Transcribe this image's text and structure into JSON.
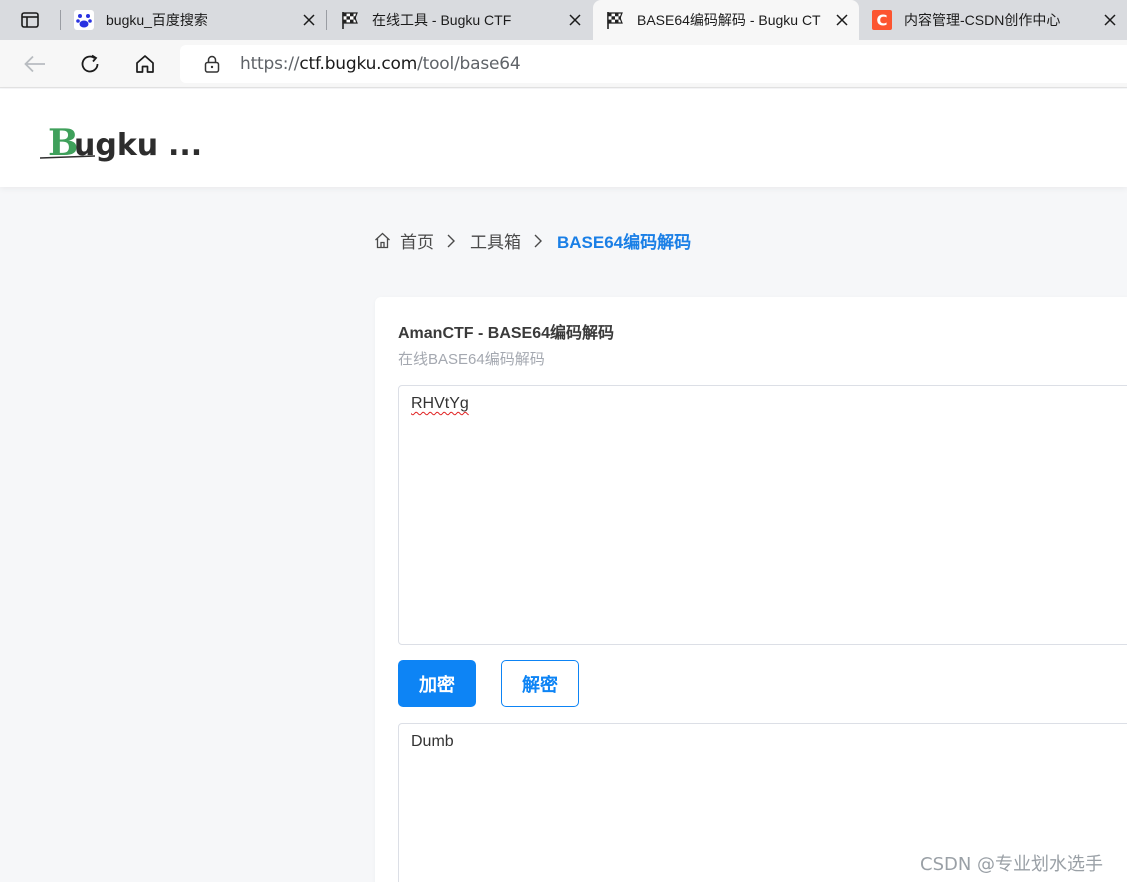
{
  "browser": {
    "tabs": [
      {
        "title": "bugku_百度搜索",
        "favicon": "baidu-paw-icon",
        "active": false
      },
      {
        "title": "在线工具 - Bugku CTF",
        "favicon": "checkered-flag-icon",
        "active": false
      },
      {
        "title": "BASE64编码解码 - Bugku CT",
        "favicon": "checkered-flag-icon",
        "active": true
      },
      {
        "title": "内容管理-CSDN创作中心",
        "favicon": "csdn-c-icon",
        "active": false
      }
    ],
    "url_prefix": "https://",
    "url_host": "ctf.bugku.com",
    "url_path": "/tool/base64",
    "colors": {
      "csdn_brand": "#fc5531",
      "baidu_brand": "#2932e1"
    }
  },
  "site": {
    "logo_text": "Bugku...",
    "breadcrumb": {
      "home": "首页",
      "toolbox": "工具箱",
      "current": "BASE64编码解码"
    }
  },
  "tool": {
    "title": "AmanCTF - BASE64编码解码",
    "subtitle": "在线BASE64编码解码",
    "input_value": "RHVtYg",
    "encrypt_label": "加密",
    "decrypt_label": "解密",
    "output_value": "Dumb"
  },
  "watermark": "CSDN @专业划水选手",
  "colors": {
    "accent": "#0d84f5",
    "logo_green": "#3fa05b"
  }
}
